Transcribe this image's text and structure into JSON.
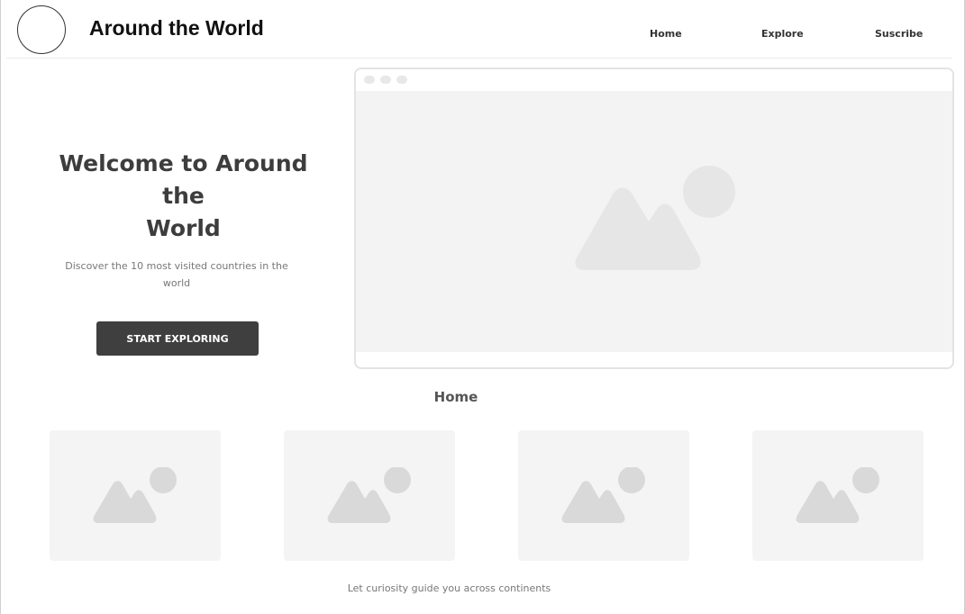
{
  "header": {
    "site_title": "Around the World",
    "nav": [
      {
        "label": "Home"
      },
      {
        "label": "Explore"
      },
      {
        "label": "Suscribe"
      }
    ]
  },
  "hero": {
    "heading_line1": "Welcome to Around the",
    "heading_line2": "World",
    "subtitle_line1": "Discover the 10 most visited countries in the",
    "subtitle_line2": "world",
    "cta_label": "START EXPLORING",
    "image_icon": "image-placeholder-icon"
  },
  "section": {
    "heading": "Home"
  },
  "cards": [
    {
      "icon": "image-placeholder-icon"
    },
    {
      "icon": "image-placeholder-icon"
    },
    {
      "icon": "image-placeholder-icon"
    },
    {
      "icon": "image-placeholder-icon"
    }
  ],
  "footer": {
    "tagline": "Let curiosity guide you across continents"
  },
  "colors": {
    "button_bg": "#3f3f3f",
    "placeholder_bg": "#f4f3f3",
    "placeholder_shape": "#e6e6e6",
    "card_shape": "#d9d9d9"
  }
}
